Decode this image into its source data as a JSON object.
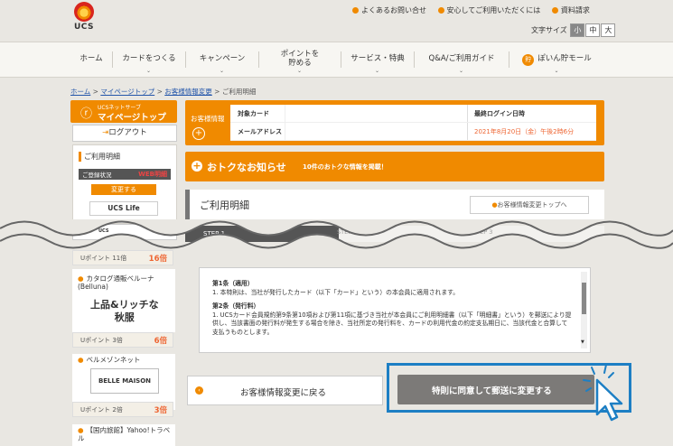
{
  "brand": {
    "logo_text": "UCS"
  },
  "top_links": [
    "よくあるお問い合せ",
    "安心してご利用いただくには",
    "資料請求"
  ],
  "font_size": {
    "label": "文字サイズ",
    "options": [
      "小",
      "中",
      "大"
    ],
    "selected": "小"
  },
  "nav": {
    "items": [
      "ホーム",
      "カードをつくる",
      "キャンペーン",
      "ポイントを\n貯める",
      "サービス・特典",
      "Q&A/ご利用ガイド",
      "ぽいん貯モール"
    ],
    "mole_icon_text": "貯"
  },
  "breadcrumb": [
    "ホーム",
    "マイページトップ",
    "お客様情報変更",
    "ご利用明細"
  ],
  "sidebar": {
    "mypage_small": "UCSネットサーブ",
    "mypage_label": "マイページトップ",
    "logout": "ログアウト",
    "meisai_title": "ご利用明細",
    "status_label": "ご登録状況",
    "status_value": "WEB明細",
    "change_btn": "変更する",
    "ucslife": "UCS Life",
    "banner_mark": "UCS",
    "points": [
      {
        "label": "Uポイント 11倍",
        "value": "16倍"
      },
      {
        "label": "Uポイント 3倍",
        "value": "6倍"
      },
      {
        "label": "Uポイント 2倍",
        "value": "3倍"
      }
    ],
    "catalog_title": "カタログ通販ベルーナ\n(Belluna)",
    "catalog_big": "上品&リッチな\n秋服",
    "belle_title": "ベルメゾンネット",
    "belle_logo": "BELLE MAISON",
    "yahoo_title": "【国内旅館】Yahoo!トラベ\nル"
  },
  "customer_info": {
    "label": "お客様情報",
    "rows": [
      {
        "key": "対象カード",
        "key2": "最終ログイン日時"
      },
      {
        "key": "メールアドレス",
        "value2": "2021年8月20日（金）午後2時6分"
      }
    ]
  },
  "otoku": {
    "title": "おトクなお知らせ",
    "sub": "10件のおトクな情報を掲載！"
  },
  "meisai_section": {
    "title": "ご利用明細",
    "back_to_top": "お客様情報変更トップへ"
  },
  "steps": [
    "STEP 1",
    "STEP 2",
    "STEP 3"
  ],
  "terms": {
    "h1": "第1条（適用）",
    "p1": "1. 本特則は、当社が発行したカード（以下「カード」という）の本会員に適用されます。",
    "h2": "第2条（発行料）",
    "p2": "1. UCSカード会員規約第9条第10項および第11項に基づき当社が本会員にご利用明細書（以下「明細書」という）を郵送により提供し、当該書面の発行料が発生する場合を除き、当社所定の発行料を、カードの利用代金の約定支払期日に、当該代金と合算して支払うものとします。"
  },
  "buttons": {
    "back": "お客様情報変更に戻る",
    "agree": "特則に同意して郵送に変更する"
  }
}
